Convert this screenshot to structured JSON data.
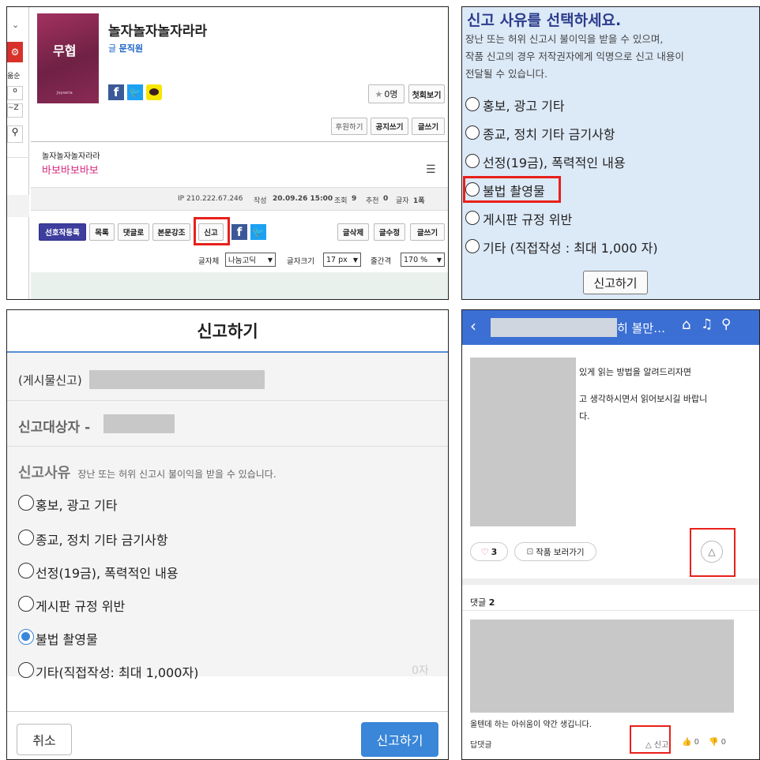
{
  "panel_a": {
    "sidebar": {
      "sort_label": "옮순",
      "o_label": "o",
      "z_label": "~Z"
    },
    "book": {
      "cover_title": "무협",
      "cover_small": "Joyseria",
      "title": "놀자놀자놀자라라",
      "author_prefix": "글",
      "author": "문직원"
    },
    "favorite_count": "0명",
    "first_view_label": "첫회보기",
    "donate_label": "후원하기",
    "notice_write_label": "공지쓰기",
    "write_label": "글쓰기",
    "post": {
      "series": "놀자놀자놀자라라",
      "title": "바보바보바보",
      "meta_ip": "IP 210.222.67.246",
      "meta_date_label": "작성",
      "meta_date": "20.09.26 15:00",
      "meta_views_label": "조회",
      "meta_views": "9",
      "meta_recommend_label": "추천",
      "meta_recommend": "0",
      "meta_chars_label": "글자",
      "meta_chars": "1폭"
    },
    "actions": {
      "favorite_register": "선호작등록",
      "list": "목록",
      "comment": "댓글로",
      "emphasis": "본문강조",
      "report": "신고",
      "delete": "글삭제",
      "edit": "글수정",
      "write": "글쓰기"
    },
    "font_label": "글자체",
    "font_value": "나눔고딕",
    "size_label": "글자크기",
    "size_value": "17 px",
    "spacing_label": "줄간격",
    "spacing_value": "170 %"
  },
  "panel_b": {
    "heading": "신고 사유를 선택하세요.",
    "desc_1": "장난 또는 허위 신고시 불이익을 받을 수 있으며,",
    "desc_2": "작품 신고의 경우 저작권자에게 익명으로 신고 내용이",
    "desc_3": "전달될 수 있습니다.",
    "options": [
      "홍보, 광고 기타",
      "종교, 정치 기타 금기사항",
      "선정(19금), 폭력적인 내용",
      "불법 촬영물",
      "게시판 규정 위반",
      "기타 (직접작성 : 최대 1,000 자)"
    ],
    "submit_label": "신고하기"
  },
  "panel_c": {
    "title": "신고하기",
    "post_prefix": "(게시물신고)",
    "target_label": "신고대상자 -",
    "reason_label": "신고사유",
    "reason_note": "장난 또는 허위 신고시 불이익을 받을 수 있습니다.",
    "options": [
      "홍보, 광고 기타",
      "종교, 정치 기타 금기사항",
      "선정(19금), 폭력적인 내용",
      "게시판 규정 위반",
      "불법 촬영물",
      "기타(직접작성: 최대 1,000자)"
    ],
    "selected_option": "불법 촬영물",
    "char_count": "0자",
    "cancel_label": "취소",
    "submit_label": "신고하기",
    "accent_color": "#3a86d8"
  },
  "panel_d": {
    "header_title": "히 볼만…",
    "body_line_1": "있게 읽는 방법을 알려드리자면",
    "body_line_2": "고 생각하시면서 읽어보시길 바랍니",
    "body_line_3": "다.",
    "like_count": "3",
    "view_work_label": "작품 보러가기",
    "comments_label": "댓글",
    "comments_count": "2",
    "comment_text": "올텐데 하는 아쉬움이 약간 생깁니다.",
    "reply_label": "답댓글",
    "report_label": "신고",
    "up_count": "0",
    "down_count": "0",
    "header_color": "#3b6fd4"
  },
  "highlight_color": "#e8201a"
}
